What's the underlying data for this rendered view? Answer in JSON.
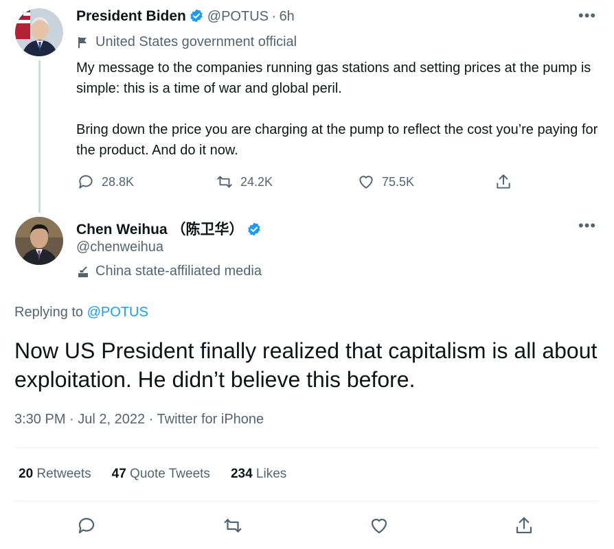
{
  "parent_tweet": {
    "author_name": "President Biden",
    "handle": "@POTUS",
    "separator": "·",
    "time_ago": "6h",
    "label": "United States government official",
    "text_paragraph_1": "My message to the companies running gas stations and setting prices at the pump is simple: this is a time of war and global peril.",
    "text_paragraph_2": "Bring down the price you are charging at the pump to reflect the cost you’re paying for the product. And do it now.",
    "reply_count": "28.8K",
    "retweet_count": "24.2K",
    "like_count": "75.5K",
    "more_icon": "more-dots-icon"
  },
  "main_tweet": {
    "author_name": "Chen Weihua （陈卫华）",
    "handle": "@chenweihua",
    "label": "China state-affiliated media",
    "replying_prefix": "Replying to",
    "replying_to": "@POTUS",
    "text": "Now US President finally realized that capitalism is all about exploitation. He didn’t believe this before.",
    "timestamp": "3:30 PM · Jul 2, 2022 · Twitter for iPhone",
    "retweets_count": "20",
    "retweets_label": "Retweets",
    "quote_count": "47",
    "quote_label": "Quote Tweets",
    "likes_count": "234",
    "likes_label": "Likes"
  },
  "colors": {
    "accent": "#1d9bf0",
    "muted": "#536471",
    "text": "#0f1419",
    "divider": "#eff3f4"
  }
}
